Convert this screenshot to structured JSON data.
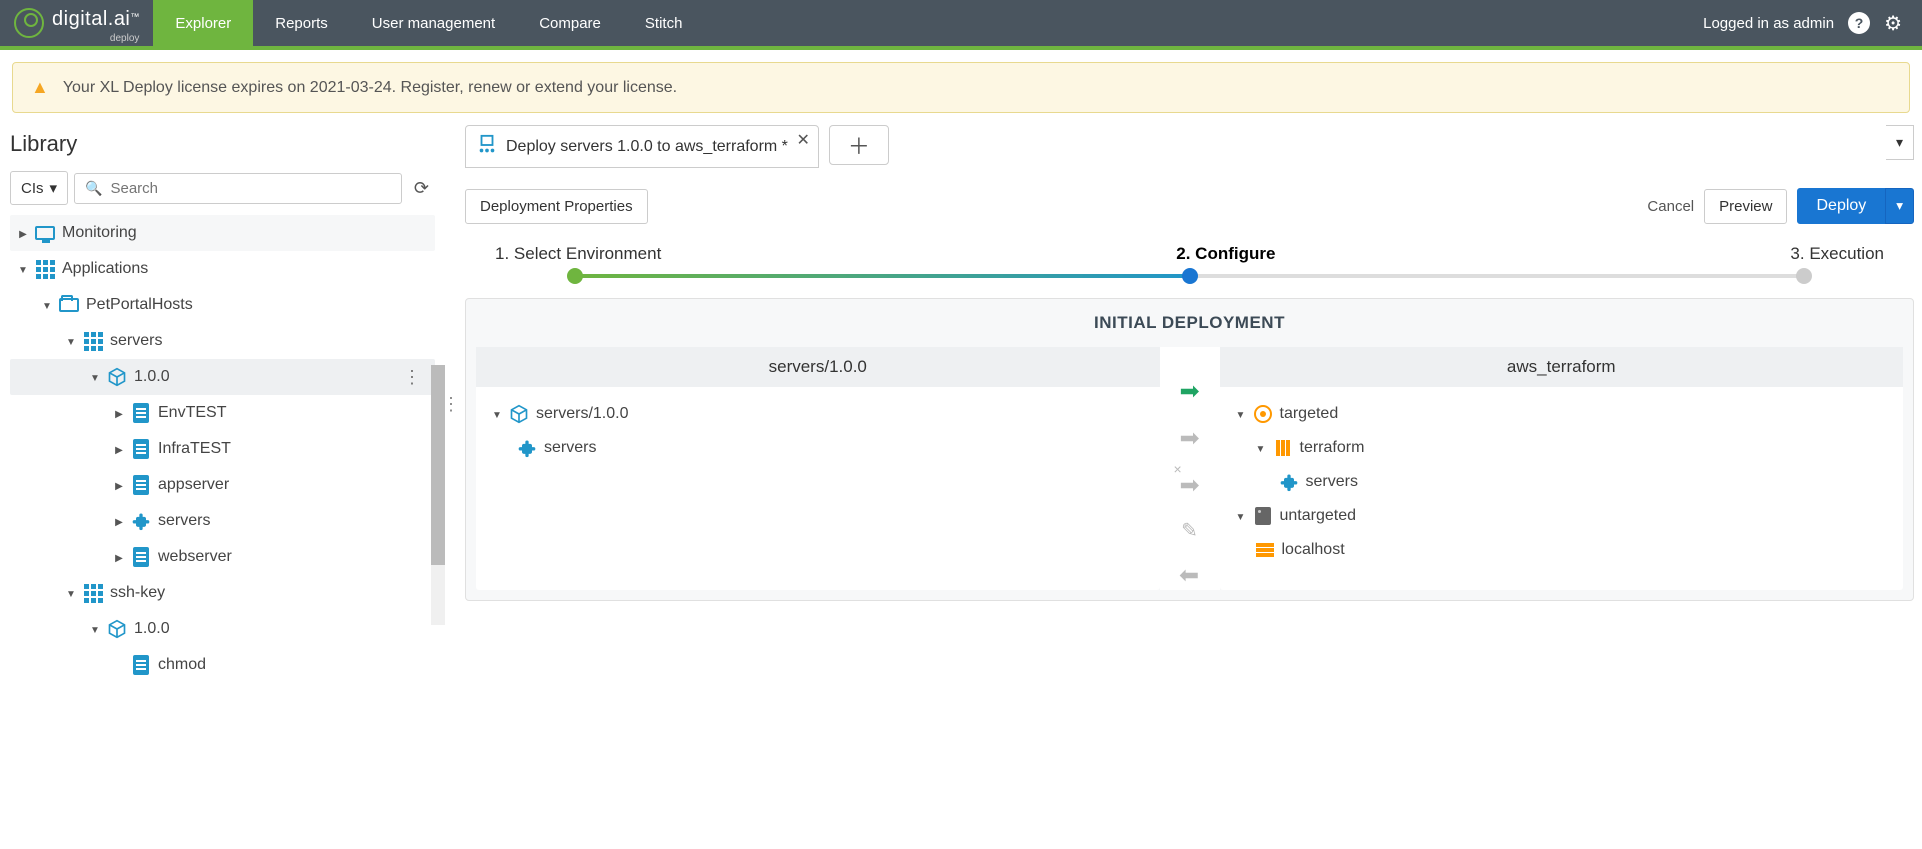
{
  "header": {
    "brand": "digital.ai",
    "brand_sub": "deploy",
    "nav": [
      "Explorer",
      "Reports",
      "User management",
      "Compare",
      "Stitch"
    ],
    "login_text": "Logged in as admin"
  },
  "banner": {
    "text": "Your XL Deploy license expires on 2021-03-24. Register, renew or extend your license."
  },
  "sidebar": {
    "title": "Library",
    "cis_label": "CIs",
    "search_placeholder": "Search",
    "tree": {
      "monitoring": "Monitoring",
      "applications": "Applications",
      "petportal": "PetPortalHosts",
      "servers": "servers",
      "v100": "1.0.0",
      "envtest": "EnvTEST",
      "infratest": "InfraTEST",
      "appserver": "appserver",
      "servers_leaf": "servers",
      "webserver": "webserver",
      "sshkey": "ssh-key",
      "sshkey_v": "1.0.0",
      "chmod": "chmod"
    }
  },
  "tab": {
    "title": "Deploy servers 1.0.0 to aws_terraform *"
  },
  "actions": {
    "dep_props": "Deployment Properties",
    "cancel": "Cancel",
    "preview": "Preview",
    "deploy": "Deploy"
  },
  "stepper": {
    "s1": "1. Select Environment",
    "s2": "2. Configure",
    "s3": "3. Execution"
  },
  "deployment": {
    "title": "INITIAL DEPLOYMENT",
    "left_header": "servers/1.0.0",
    "left_pkg": "servers/1.0.0",
    "left_item": "servers",
    "right_header": "aws_terraform",
    "targeted": "targeted",
    "terraform": "terraform",
    "servers": "servers",
    "untargeted": "untargeted",
    "localhost": "localhost"
  }
}
